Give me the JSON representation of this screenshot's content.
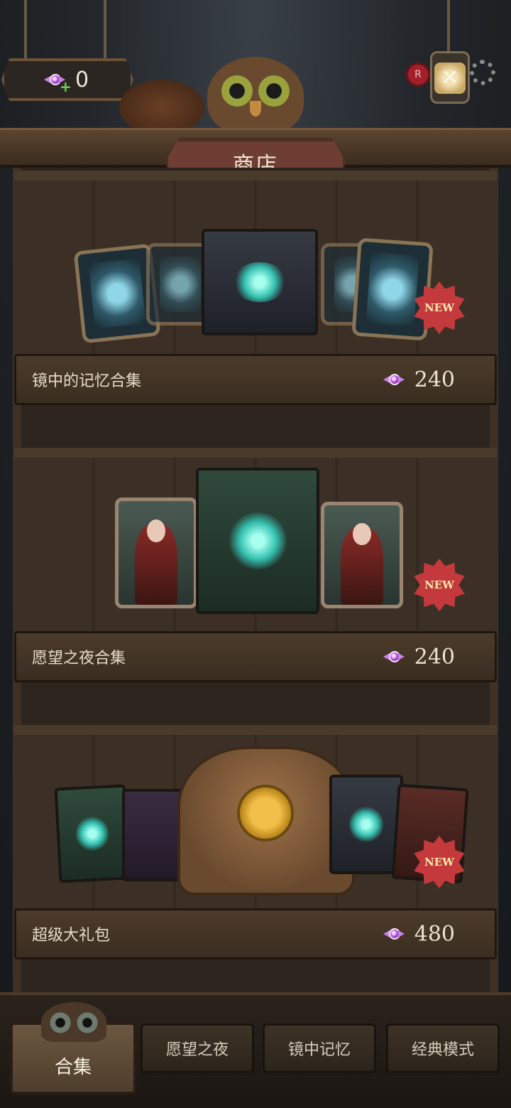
{
  "header": {
    "currency_value": "0",
    "title": "商店",
    "seal_letter": "R",
    "close_symbol": "✕"
  },
  "shelves": [
    {
      "name": "镜中的记忆合集",
      "price": "240",
      "badge": "NEW"
    },
    {
      "name": "愿望之夜合集",
      "price": "240",
      "badge": "NEW"
    },
    {
      "name": "超级大礼包",
      "price": "480",
      "badge": "NEW"
    }
  ],
  "tabs": {
    "active": "合集",
    "items": [
      "愿望之夜",
      "镜中记忆",
      "经典模式"
    ]
  },
  "colors": {
    "candy": "#b250d8",
    "new_badge": "#c43a3c",
    "title_plate": "#6e3e34"
  },
  "icons": [
    "candy-icon",
    "plus-icon",
    "owl",
    "close-icon",
    "gear-icon",
    "seal-icon"
  ]
}
